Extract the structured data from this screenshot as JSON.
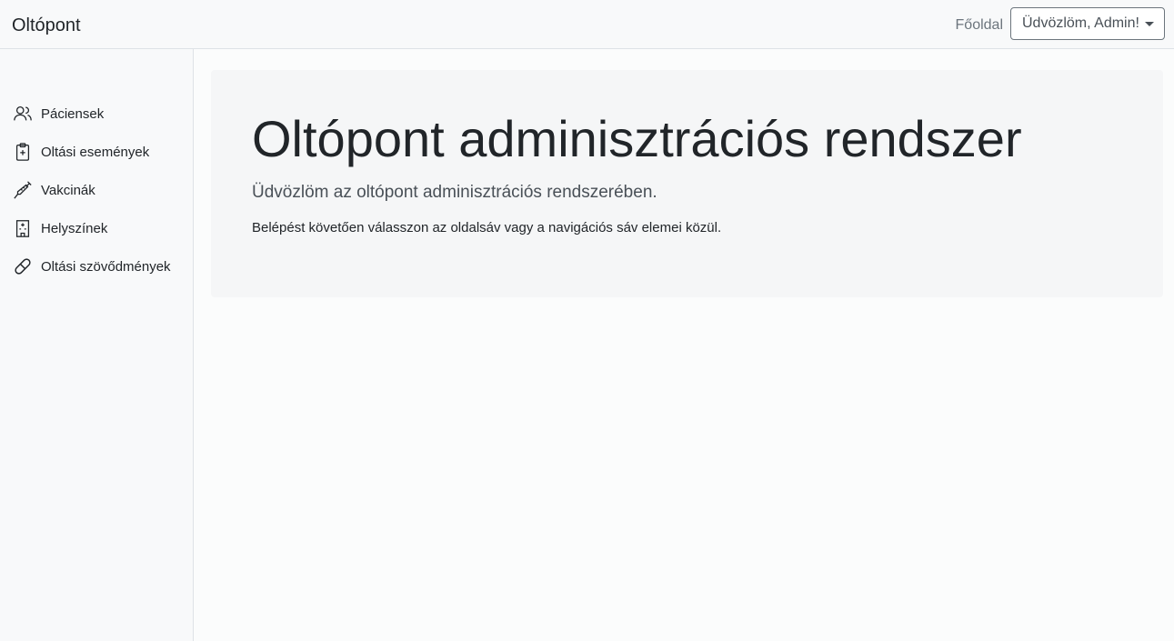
{
  "navbar": {
    "brand": "Oltópont",
    "home_link": "Főoldal",
    "user_menu_label": "Üdvözlöm, Admin!"
  },
  "sidebar": {
    "items": [
      {
        "label": "Páciensek",
        "icon": "people-icon"
      },
      {
        "label": "Oltási események",
        "icon": "clipboard-plus-icon"
      },
      {
        "label": "Vakcinák",
        "icon": "syringe-icon"
      },
      {
        "label": "Helyszínek",
        "icon": "hospital-icon"
      },
      {
        "label": "Oltási szövődmények",
        "icon": "capsule-icon"
      }
    ]
  },
  "main": {
    "title": "Oltópont adminisztrációs rendszer",
    "lead": "Üdvözlöm az oltópont adminisztrációs rendszerében.",
    "text": "Belépést követően válasszon az oldalsáv vagy a navigációs sáv elemei közül."
  }
}
